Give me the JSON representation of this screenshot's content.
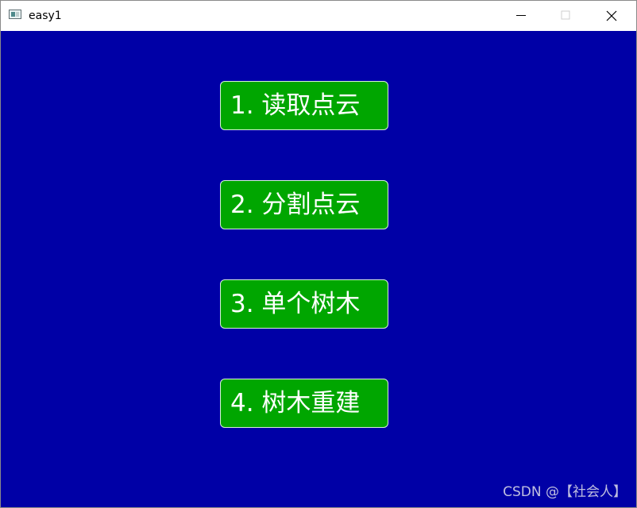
{
  "window": {
    "title": "easy1",
    "controls": {
      "minimize_icon": "minimize-icon",
      "maximize_icon": "maximize-icon",
      "close_icon": "close-icon"
    }
  },
  "colors": {
    "background": "#0000a6",
    "button": "#00a600",
    "text": "#ffffff"
  },
  "menu": {
    "items": [
      {
        "label": "1. 读取点云"
      },
      {
        "label": "2. 分割点云"
      },
      {
        "label": "3. 单个树木"
      },
      {
        "label": "4. 树木重建"
      }
    ]
  },
  "watermark": {
    "text": "CSDN @【社会人】"
  }
}
